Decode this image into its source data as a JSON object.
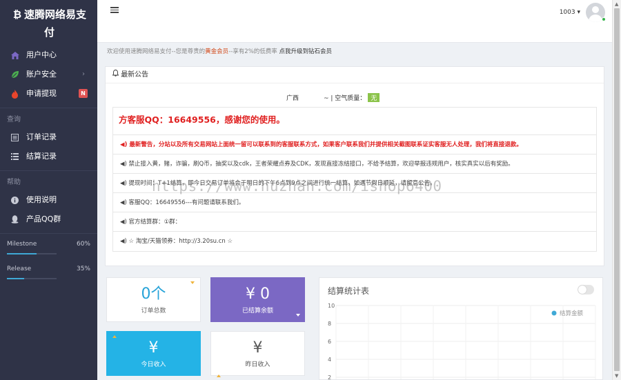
{
  "sidebar": {
    "brand_icon": "bitcoin-icon",
    "brand_line1": "速腾网络易支",
    "brand_line2": "付",
    "items": [
      {
        "label": "用户中心",
        "icon": "home-icon"
      },
      {
        "label": "账户安全",
        "icon": "leaf-icon"
      },
      {
        "label": "申请提现",
        "icon": "fire-icon",
        "badge": "N"
      }
    ],
    "query_label": "查询",
    "query_items": [
      {
        "label": "订单记录",
        "icon": "list-alt-icon"
      },
      {
        "label": "结算记录",
        "icon": "list-icon"
      }
    ],
    "help_label": "帮助",
    "help_items": [
      {
        "label": "使用说明",
        "icon": "info-icon"
      },
      {
        "label": "产品QQ群",
        "icon": "qq-icon"
      }
    ],
    "progress": [
      {
        "label": "Milestone",
        "percent_text": "60%",
        "value": 0.6
      },
      {
        "label": "Release",
        "percent_text": "35%",
        "value": 0.35
      }
    ]
  },
  "header": {
    "user_id": "1003 ▾"
  },
  "welcome": {
    "prefix": "欢迎使用速腾网络易支付--您是尊贵的",
    "level": "黄金会员",
    "middle": "--享有2%的低费率",
    "upgrade": "点我升级到钻石会员"
  },
  "notice": {
    "header": "最新公告",
    "weather_city": "广西",
    "weather_text": "~ | 空气质量：",
    "weather_aq": "无",
    "title": "方客服QQ：16649556，感谢您的使用。",
    "rows": [
      "◀) 最新警告，分站以及所有交易网站上面统一留可以联系到的客服联系方式，如果客户联系我们并提供相关截图联系证实客服无人处理，我们将直接退款。",
      "◀) 禁止接入黄，赌，诈骗，刷Q币，抽奖以及cdk，王者荣耀点券及CDK，发现直接冻结接口，不给予结算，欢迎举报违规用户，核实真实以后有奖励。",
      "◀) 提现时间：T+1结算，即今日交易订单将会于明日的下午6点到9点之间进行统一结算，如遇节假日顺延，请留意公告。",
      "◀) 客服QQ：16649556---有问题请联系我们。",
      "◀) 官方结算群：①群：",
      "◀) ☆ 淘宝/天猫领券：http://3.20su.cn ☆"
    ]
  },
  "watermark": "https://www.huzhan.com/ishop6400",
  "cards": {
    "orders": {
      "value": "0个",
      "label": "订单总数"
    },
    "balance": {
      "value": "¥ 0",
      "label": "已结算余额"
    },
    "today": {
      "value": "¥",
      "label": "今日收入"
    },
    "yesterday": {
      "value": "¥",
      "label": "昨日收入"
    }
  },
  "chart_data": {
    "type": "line",
    "title": "结算统计表",
    "series": [
      {
        "name": "结算金额",
        "values": []
      }
    ],
    "y_ticks": [
      "10",
      "8",
      "6",
      "4",
      "2"
    ],
    "ylim": [
      0,
      10
    ],
    "grid": true,
    "legend": "top-right",
    "series_color": "#3fa9d6"
  }
}
